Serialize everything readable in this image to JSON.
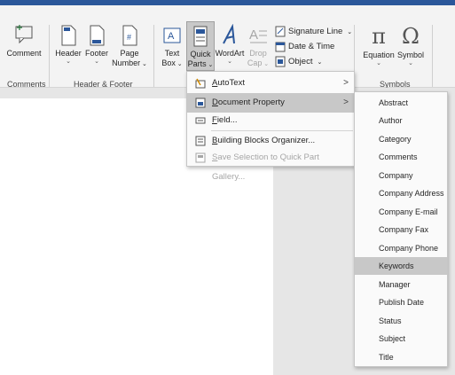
{
  "ribbon": {
    "comment_label": "Comment",
    "header_label": "Header",
    "footer_label": "Footer",
    "page_label": "Page",
    "number_label": "Number",
    "text_label": "Text",
    "box_label": "Box",
    "quick_label": "Quick",
    "parts_label": "Parts",
    "wordart_label": "WordArt",
    "drop_label": "Drop",
    "cap_label": "Cap",
    "signature_label": "Signature Line",
    "datetime_label": "Date & Time",
    "object_label": "Object",
    "equation_label": "Equation",
    "symbol_label": "Symbol",
    "group_comments": "Comments",
    "group_header_footer": "Header & Footer",
    "group_symbols": "Symbols",
    "icons": [
      "comment-icon",
      "header-icon",
      "footer-icon",
      "page-number-icon",
      "textbox-icon",
      "quick-parts-icon",
      "wordart-icon",
      "drop-cap-icon",
      "signature-line-icon",
      "date-time-icon",
      "object-icon",
      "equation-icon",
      "symbol-icon"
    ],
    "accent": "#2b579a"
  },
  "quick_parts_menu": {
    "items": [
      {
        "accel": "A",
        "rest": "utoText",
        "icon": "autotext-icon",
        "has_submenu": true
      },
      {
        "accel": "D",
        "rest": "ocument Property",
        "icon": "document-property-icon",
        "has_submenu": true,
        "highlighted": true
      },
      {
        "accel": "F",
        "rest": "ield...",
        "icon": "field-icon"
      },
      {
        "accel": "B",
        "rest": "uilding Blocks Organizer...",
        "icon": "building-blocks-icon"
      },
      {
        "accel": "S",
        "rest": "ave Selection to Quick Part Gallery...",
        "icon": "save-selection-icon",
        "disabled": true
      }
    ]
  },
  "document_property_submenu": {
    "items": [
      "Abstract",
      "Author",
      "Category",
      "Comments",
      "Company",
      "Company Address",
      "Company E-mail",
      "Company Fax",
      "Company Phone",
      "Keywords",
      "Manager",
      "Publish Date",
      "Status",
      "Subject",
      "Title"
    ],
    "highlighted": "Keywords"
  }
}
